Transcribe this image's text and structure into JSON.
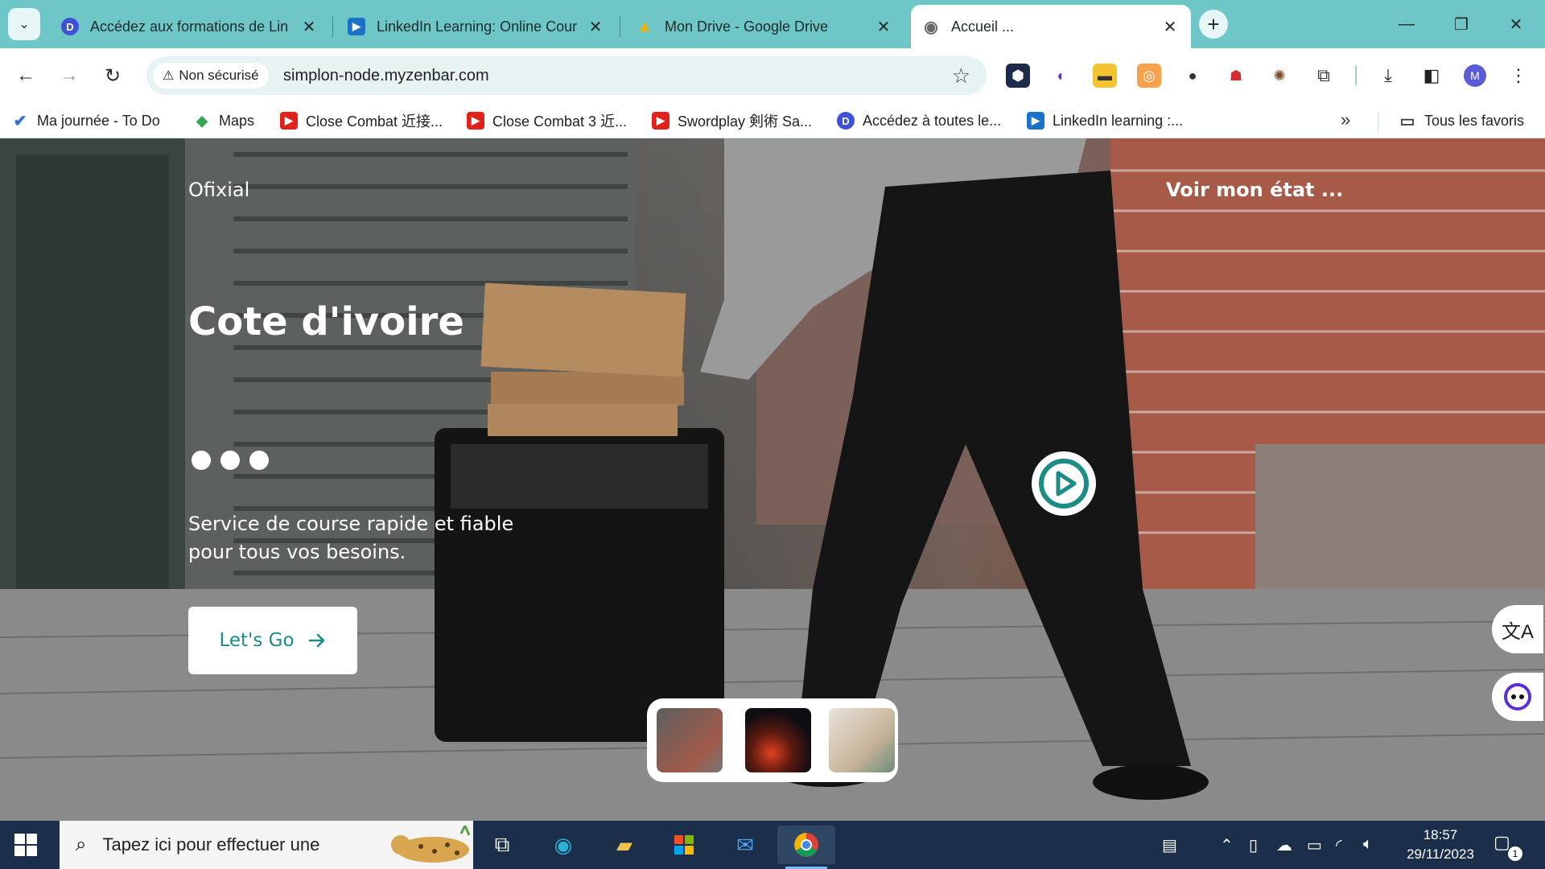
{
  "browser": {
    "tabs": [
      {
        "title": "Accédez aux formations de Lin",
        "favicon": "D",
        "favicon_color": "#3f51d6"
      },
      {
        "title": "LinkedIn Learning: Online Cour",
        "favicon": "▶",
        "favicon_color": "#1a73c8"
      },
      {
        "title": "Mon Drive - Google Drive",
        "favicon": "▲",
        "favicon_color": "#f2b400"
      },
      {
        "title": "Accueil ...",
        "favicon": "◉",
        "favicon_color": "#6a6a6a"
      }
    ],
    "close_glyph": "✕",
    "new_tab_glyph": "+",
    "security_label": "Non sécurisé",
    "url": "simplon-node.myzenbar.com",
    "profile_initial": "M",
    "bookmarks": [
      {
        "label": "Ma journée - To Do",
        "icon": "✔",
        "color": "#2f72d6"
      },
      {
        "label": "Maps",
        "icon": "◆",
        "color": "#34a853"
      },
      {
        "label": "Close Combat 近接...",
        "icon": "▶",
        "color": "#e0221b"
      },
      {
        "label": "Close Combat 3 近...",
        "icon": "▶",
        "color": "#e0221b"
      },
      {
        "label": "Swordplay 剣術 Sa...",
        "icon": "▶",
        "color": "#e0221b"
      },
      {
        "label": "Accédez à toutes le...",
        "icon": "D",
        "color": "#3f51d6"
      },
      {
        "label": "LinkedIn learning :...",
        "icon": "▶",
        "color": "#1a73c8"
      }
    ],
    "bookmarks_overflow": "»",
    "all_bookmarks_label": "Tous les favoris"
  },
  "page": {
    "brand": "Ofixial",
    "status_link": "Voir mon état ...",
    "title": "Cote d'ivoire",
    "subtitle": "Service de course rapide et fiable pour tous vos besoins.",
    "cta_label": "Let's Go",
    "accent_color": "#1c8c86"
  },
  "taskbar": {
    "search_placeholder": "Tapez ici pour effectuer une",
    "time": "18:57",
    "date": "29/11/2023",
    "notification_count": "1"
  }
}
